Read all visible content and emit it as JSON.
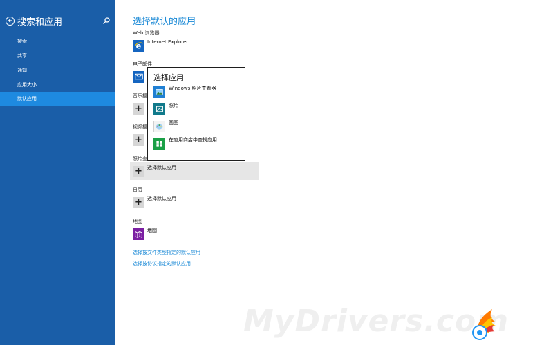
{
  "sidebar": {
    "title": "搜索和应用",
    "items": [
      {
        "label": "搜索"
      },
      {
        "label": "共享"
      },
      {
        "label": "通知"
      },
      {
        "label": "应用大小"
      },
      {
        "label": "默认应用"
      }
    ]
  },
  "main": {
    "title": "选择默认的应用",
    "sections": {
      "web": {
        "label": "Web 浏览器",
        "app": "Internet Explorer"
      },
      "email": {
        "label": "电子邮件",
        "app": ""
      },
      "music": {
        "label": "音乐播",
        "app": ""
      },
      "video": {
        "label": "视频播",
        "app": ""
      },
      "photo": {
        "label": "照片查看",
        "app": "选择默认应用"
      },
      "calendar": {
        "label": "日历",
        "app": "选择默认应用"
      },
      "maps": {
        "label": "地图",
        "app": "地图"
      }
    },
    "links": [
      "选择按文件类型指定的默认应用",
      "选择按协议指定的默认应用"
    ]
  },
  "popup": {
    "title": "选择应用",
    "items": [
      {
        "label": "Windows 照片查看器"
      },
      {
        "label": "照片"
      },
      {
        "label": "画图"
      },
      {
        "label": "在应用商店中查找应用"
      }
    ]
  },
  "watermark": {
    "text": "MyDrivers.com"
  },
  "colors": {
    "sidebar_bg": "#1a5ea8",
    "active_item": "#1e8ae0",
    "accent": "#1a89d6"
  }
}
